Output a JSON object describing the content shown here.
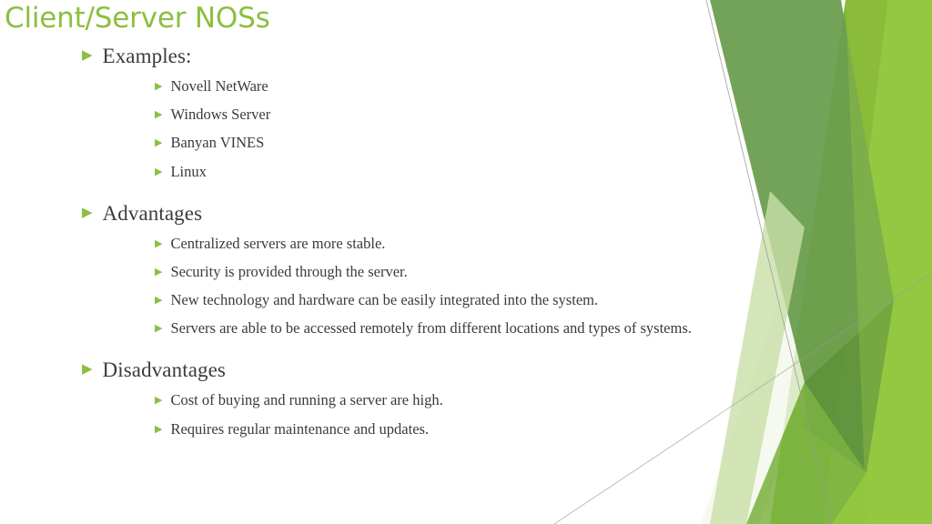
{
  "slide": {
    "title": "Client/Server NOSs",
    "title_color": "#8cbf3f",
    "body_text_color": "#3b3b3b",
    "bullet_color": "#8cbf3f",
    "background_color": "#ffffff",
    "bullet_glyph": "▶",
    "groups": [
      {
        "heading": "Examples:",
        "items": [
          "Novell NetWare",
          "Windows Server",
          "Banyan VINES",
          "Linux"
        ]
      },
      {
        "heading": "Advantages",
        "items": [
          "Centralized servers are more stable.",
          "Security is provided through the server.",
          "New technology and hardware can be easily integrated into the system.",
          "Servers are able to be accessed remotely from different locations and types of systems."
        ]
      },
      {
        "heading": "Disadvantages",
        "items": [
          "Cost of buying and running a server are high.",
          "Requires regular maintenance and updates."
        ]
      }
    ]
  },
  "decoration": {
    "name": "facet-theme-polygons",
    "colors": {
      "dark_green": "#6c9e4f",
      "mid_green": "#7cb342",
      "bright_green": "#93c63f",
      "bright_green_alt": "#81b334",
      "pale_green": "#c9dfa8",
      "pale_green_light": "#dce9c8",
      "very_pale_green": "#eef5e2",
      "hairline": "#9a9a9a"
    }
  }
}
